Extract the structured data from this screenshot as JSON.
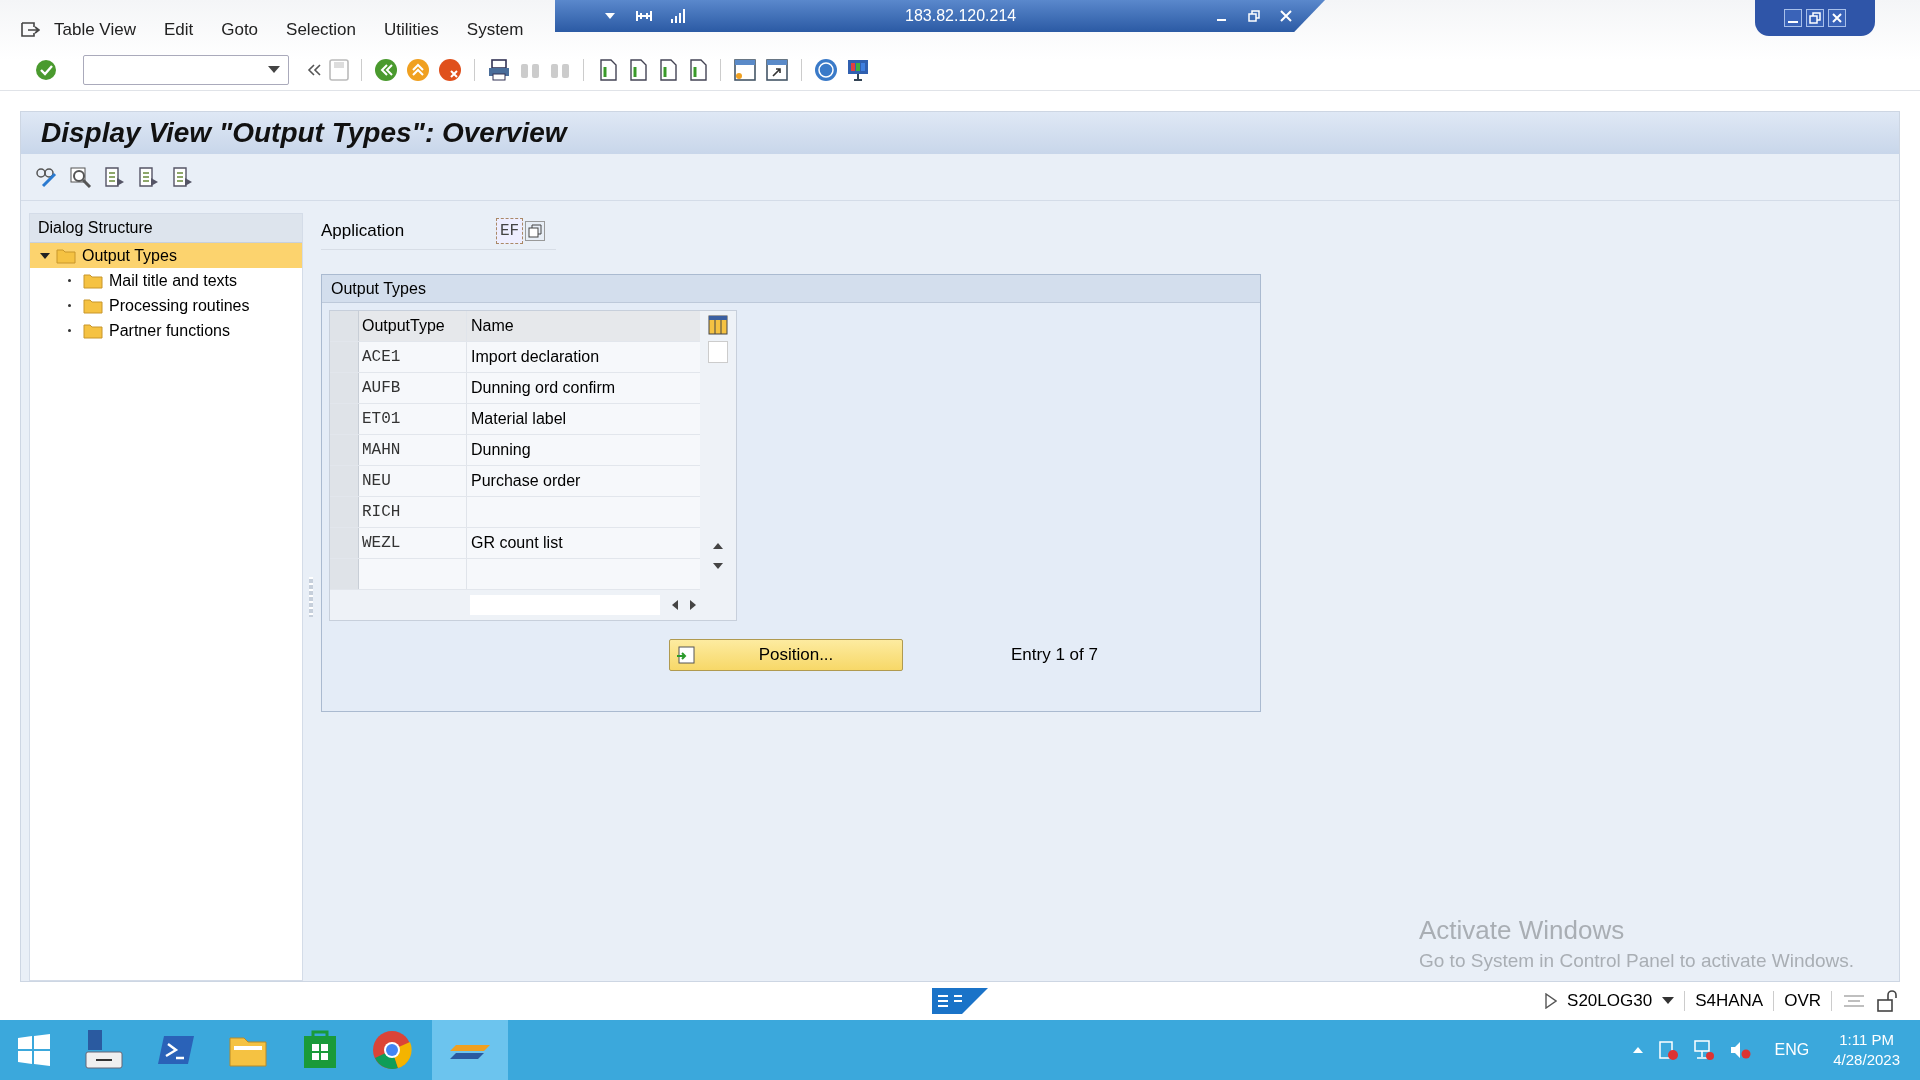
{
  "rdp_bar": {
    "address": "183.82.120.214"
  },
  "menu": [
    "Table View",
    "Edit",
    "Goto",
    "Selection",
    "Utilities",
    "System"
  ],
  "title": "Display View \"Output Types\": Overview",
  "dialog_structure": {
    "title": "Dialog Structure",
    "tree": [
      {
        "label": "Output Types",
        "selected": true,
        "expanded": true,
        "children": [
          {
            "label": "Mail title and texts",
            "selected": false
          },
          {
            "label": "Processing routines",
            "selected": false
          },
          {
            "label": "Partner functions",
            "selected": false
          }
        ]
      }
    ]
  },
  "application": {
    "label": "Application",
    "value": "EF"
  },
  "output_types": {
    "title": "Output Types",
    "columns": [
      "OutputType",
      "Name"
    ],
    "rows": [
      {
        "output_type": "ACE1",
        "name": "Import declaration"
      },
      {
        "output_type": "AUFB",
        "name": "Dunning ord confirm"
      },
      {
        "output_type": "ET01",
        "name": "Material label"
      },
      {
        "output_type": "MAHN",
        "name": "Dunning"
      },
      {
        "output_type": "NEU",
        "name": "Purchase order"
      },
      {
        "output_type": "RICH"
      },
      {
        "output_type": "WEZL",
        "name": "GR count list"
      }
    ],
    "position_button": "Position...",
    "entry_info": "Entry 1 of 7"
  },
  "activation": {
    "title": "Activate Windows",
    "text": "Go to System in Control Panel to activate Windows."
  },
  "status_bar": {
    "system": "S20LOG30",
    "server": "S4HANA",
    "mode": "OVR"
  },
  "taskbar": {
    "language": "ENG",
    "time": "1:11 PM",
    "date": "4/28/2023"
  }
}
